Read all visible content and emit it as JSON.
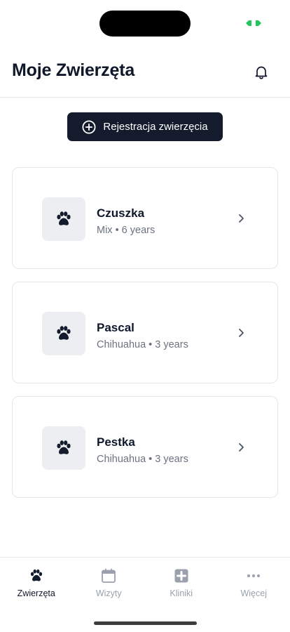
{
  "header": {
    "title": "Moje Zwierzęta"
  },
  "actions": {
    "register_label": "Rejestracja zwierzęcia"
  },
  "pets": [
    {
      "name": "Czuszka",
      "details": "Mix • 6 years"
    },
    {
      "name": "Pascal",
      "details": "Chihuahua • 3 years"
    },
    {
      "name": "Pestka",
      "details": "Chihuahua • 3 years"
    }
  ],
  "tabs": [
    {
      "label": "Zwierzęta",
      "icon": "paw-icon",
      "active": true
    },
    {
      "label": "Wizyty",
      "icon": "calendar-icon",
      "active": false
    },
    {
      "label": "Kliniki",
      "icon": "medical-cross-icon",
      "active": false
    },
    {
      "label": "Więcej",
      "icon": "more-icon",
      "active": false
    }
  ],
  "colors": {
    "primary": "#131b2c",
    "muted": "#9aa1ad",
    "status_indicator": "#22c55e"
  }
}
